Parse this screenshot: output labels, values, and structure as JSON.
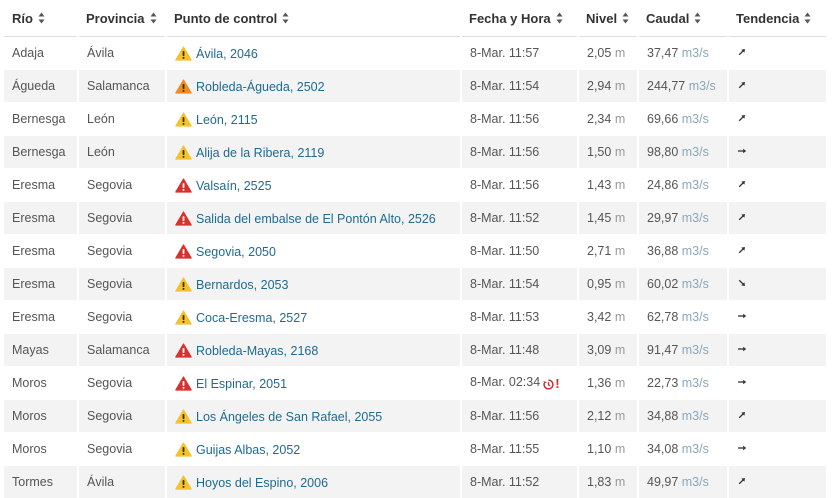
{
  "headers": {
    "rio": "Río",
    "provincia": "Provincia",
    "punto": "Punto de control",
    "fecha": "Fecha y Hora",
    "nivel": "Nivel",
    "caudal": "Caudal",
    "tendencia": "Tendencia"
  },
  "colors": {
    "yellow_warning": "#f2c230",
    "orange_warning": "#f08a24",
    "red_warning": "#d6322f",
    "link": "#1f6a90"
  },
  "rows": [
    {
      "rio": "Adaja",
      "provincia": "Ávila",
      "punto": "Ávila, 2046",
      "alert": "yellow",
      "fecha": "8-Mar. 11:57",
      "nivel": "2,05",
      "nivel_unit": "m",
      "caudal": "37,47",
      "caudal_unit": "m3/s",
      "trend": "up"
    },
    {
      "rio": "Águeda",
      "provincia": "Salamanca",
      "punto": "Robleda-Águeda, 2502",
      "alert": "orange",
      "fecha": "8-Mar. 11:54",
      "nivel": "2,94",
      "nivel_unit": "m",
      "caudal": "244,77",
      "caudal_unit": "m3/s",
      "trend": "up"
    },
    {
      "rio": "Bernesga",
      "provincia": "León",
      "punto": "León, 2115",
      "alert": "yellow",
      "fecha": "8-Mar. 11:56",
      "nivel": "2,34",
      "nivel_unit": "m",
      "caudal": "69,66",
      "caudal_unit": "m3/s",
      "trend": "up"
    },
    {
      "rio": "Bernesga",
      "provincia": "León",
      "punto": "Alija de la Ribera, 2119",
      "alert": "yellow",
      "fecha": "8-Mar. 11:56",
      "nivel": "1,50",
      "nivel_unit": "m",
      "caudal": "98,80",
      "caudal_unit": "m3/s",
      "trend": "flat"
    },
    {
      "rio": "Eresma",
      "provincia": "Segovia",
      "punto": "Valsaín, 2525",
      "alert": "red",
      "fecha": "8-Mar. 11:56",
      "nivel": "1,43",
      "nivel_unit": "m",
      "caudal": "24,86",
      "caudal_unit": "m3/s",
      "trend": "up"
    },
    {
      "rio": "Eresma",
      "provincia": "Segovia",
      "punto": "Salida del embalse de El Pontón Alto, 2526",
      "alert": "red",
      "fecha": "8-Mar. 11:52",
      "nivel": "1,45",
      "nivel_unit": "m",
      "caudal": "29,97",
      "caudal_unit": "m3/s",
      "trend": "up"
    },
    {
      "rio": "Eresma",
      "provincia": "Segovia",
      "punto": "Segovia, 2050",
      "alert": "red",
      "fecha": "8-Mar. 11:50",
      "nivel": "2,71",
      "nivel_unit": "m",
      "caudal": "36,88",
      "caudal_unit": "m3/s",
      "trend": "up"
    },
    {
      "rio": "Eresma",
      "provincia": "Segovia",
      "punto": "Bernardos, 2053",
      "alert": "yellow",
      "fecha": "8-Mar. 11:54",
      "nivel": "0,95",
      "nivel_unit": "m",
      "caudal": "60,02",
      "caudal_unit": "m3/s",
      "trend": "down"
    },
    {
      "rio": "Eresma",
      "provincia": "Segovia",
      "punto": "Coca-Eresma, 2527",
      "alert": "yellow",
      "fecha": "8-Mar. 11:53",
      "nivel": "3,42",
      "nivel_unit": "m",
      "caudal": "62,78",
      "caudal_unit": "m3/s",
      "trend": "flat"
    },
    {
      "rio": "Mayas",
      "provincia": "Salamanca",
      "punto": "Robleda-Mayas, 2168",
      "alert": "red",
      "fecha": "8-Mar. 11:48",
      "nivel": "3,09",
      "nivel_unit": "m",
      "caudal": "91,47",
      "caudal_unit": "m3/s",
      "trend": "flat"
    },
    {
      "rio": "Moros",
      "provincia": "Segovia",
      "punto": "El Espinar, 2051",
      "alert": "red",
      "fecha": "8-Mar. 02:34",
      "delayed": true,
      "nivel": "1,36",
      "nivel_unit": "m",
      "caudal": "22,73",
      "caudal_unit": "m3/s",
      "trend": "flat"
    },
    {
      "rio": "Moros",
      "provincia": "Segovia",
      "punto": "Los Ángeles de San Rafael, 2055",
      "alert": "yellow",
      "fecha": "8-Mar. 11:56",
      "nivel": "2,12",
      "nivel_unit": "m",
      "caudal": "34,88",
      "caudal_unit": "m3/s",
      "trend": "up"
    },
    {
      "rio": "Moros",
      "provincia": "Segovia",
      "punto": "Guijas Albas, 2052",
      "alert": "yellow",
      "fecha": "8-Mar. 11:55",
      "nivel": "1,10",
      "nivel_unit": "m",
      "caudal": "34,08",
      "caudal_unit": "m3/s",
      "trend": "flat"
    },
    {
      "rio": "Tormes",
      "provincia": "Ávila",
      "punto": "Hoyos del Espino, 2006",
      "alert": "yellow",
      "fecha": "8-Mar. 11:52",
      "nivel": "1,83",
      "nivel_unit": "m",
      "caudal": "49,97",
      "caudal_unit": "m3/s",
      "trend": "up"
    }
  ]
}
